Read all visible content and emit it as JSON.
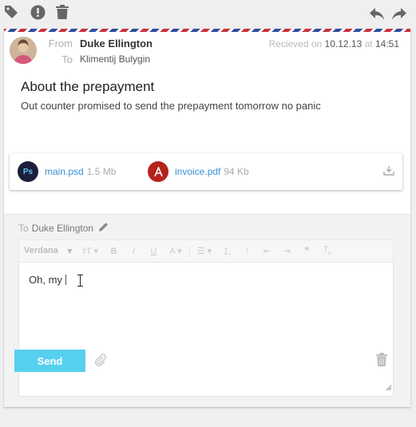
{
  "toolbar": {
    "icons": [
      "tag-icon",
      "alert-icon",
      "trash-icon",
      "reply-icon",
      "forward-icon"
    ]
  },
  "message": {
    "from_label": "From",
    "from_name": "Duke Ellington",
    "to_label": "To",
    "to_name": "Klimentij Bulygin",
    "received_prefix": "Recieved on",
    "received_date": "10.12.13",
    "received_at": "at",
    "received_time": "14:51",
    "subject": "About the prepayment",
    "body": "Out counter promised to send the prepayment tomorrow no panic"
  },
  "attachments": [
    {
      "badge": "Ps",
      "name": "main.psd",
      "size": "1.5 Mb",
      "color": "#1b1f3b"
    },
    {
      "badge": "PDF",
      "name": "invoice.pdf",
      "size": "94 Kb",
      "color": "#b3231b"
    }
  ],
  "compose": {
    "to_label": "To",
    "to_name": "Duke Ellington",
    "font": "Verdana",
    "text": "Oh, my",
    "send_label": "Send"
  },
  "colors": {
    "accent": "#57d0f0",
    "link": "#3a8ed0",
    "airmail_red": "#c8323c",
    "airmail_blue": "#2f4c9e"
  }
}
